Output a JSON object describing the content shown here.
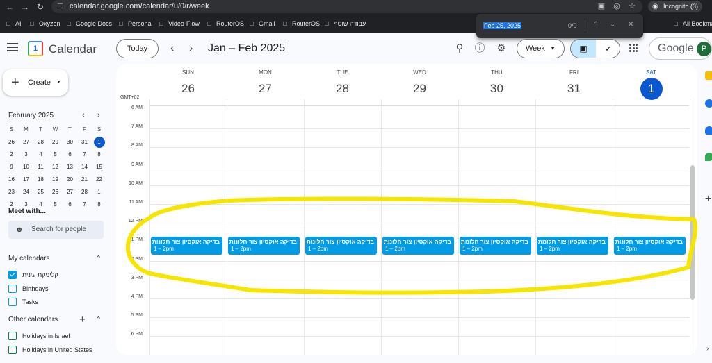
{
  "browser": {
    "url": "calendar.google.com/calendar/u/0/r/week",
    "incognito_label": "Incognito (3)",
    "bookmarks": [
      "AI",
      "Oxyzen",
      "Google Docs",
      "Personal",
      "Video-Flow",
      "RouterOS",
      "Gmail",
      "RouterOS",
      "עבודה שוטף",
      "All Bookmar"
    ],
    "find": {
      "query": "Feb 25, 2025",
      "count": "0/0"
    }
  },
  "header": {
    "app_name": "Calendar",
    "logo_day": "1",
    "today_label": "Today",
    "range_label": "Jan – Feb 2025",
    "view_label": "Week",
    "account_wordmark": "Google",
    "avatar_letter": "P"
  },
  "sidebar": {
    "create_label": "Create",
    "mini_calendar": {
      "title": "February 2025",
      "weekdays": [
        "S",
        "M",
        "T",
        "W",
        "T",
        "F",
        "S"
      ],
      "weeks": [
        [
          "26",
          "27",
          "28",
          "29",
          "30",
          "31",
          "1"
        ],
        [
          "2",
          "3",
          "4",
          "5",
          "6",
          "7",
          "8"
        ],
        [
          "9",
          "10",
          "11",
          "12",
          "13",
          "14",
          "15"
        ],
        [
          "16",
          "17",
          "18",
          "19",
          "20",
          "21",
          "22"
        ],
        [
          "23",
          "24",
          "25",
          "26",
          "27",
          "28",
          "1"
        ],
        [
          "2",
          "3",
          "4",
          "5",
          "6",
          "7",
          "8"
        ]
      ]
    },
    "meet_title": "Meet with...",
    "search_people_placeholder": "Search for people",
    "my_calendars_title": "My calendars",
    "my_calendars": [
      {
        "name": "קליניקת עינית",
        "checked": true
      },
      {
        "name": "Birthdays",
        "checked": false
      },
      {
        "name": "Tasks",
        "checked": false
      }
    ],
    "other_calendars_title": "Other calendars",
    "other_calendars": [
      {
        "name": "Holidays in Israel",
        "checked": false
      },
      {
        "name": "Holidays in United States",
        "checked": false
      }
    ]
  },
  "week": {
    "timezone": "GMT+02",
    "days": [
      {
        "name": "SUN",
        "date": "26",
        "today": false
      },
      {
        "name": "MON",
        "date": "27",
        "today": false
      },
      {
        "name": "TUE",
        "date": "28",
        "today": false
      },
      {
        "name": "WED",
        "date": "29",
        "today": false
      },
      {
        "name": "THU",
        "date": "30",
        "today": false
      },
      {
        "name": "FRI",
        "date": "31",
        "today": false
      },
      {
        "name": "SAT",
        "date": "1",
        "today": true
      }
    ],
    "hours": [
      "6 AM",
      "7 AM",
      "8 AM",
      "9 AM",
      "10 AM",
      "11 AM",
      "12 PM",
      "1 PM",
      "2 PM",
      "3 PM",
      "4 PM",
      "5 PM",
      "6 PM"
    ],
    "events": [
      {
        "day": 0,
        "title": "בדיקה אוקסיון צור חלונות",
        "time": "1 – 2pm"
      },
      {
        "day": 1,
        "title": "בדיקה אוקסיון צור חלונות",
        "time": "1 – 2pm"
      },
      {
        "day": 2,
        "title": "בדיקה אוקסיון צור חלונות",
        "time": "1 – 2pm"
      },
      {
        "day": 3,
        "title": "בדיקה אוקסיון צור חלונות",
        "time": "1 – 2pm"
      },
      {
        "day": 4,
        "title": "בדיקה אוקסיון צור חלונות",
        "time": "1 – 2pm"
      },
      {
        "day": 5,
        "title": "בדיקה אוקסיון צור חלונות",
        "time": "1 – 2pm"
      },
      {
        "day": 6,
        "title": "בדיקה אוקסיון צור חלונות",
        "time": "1 – 2pm"
      }
    ]
  },
  "colors": {
    "event": "#039be5",
    "today": "#0b57d0",
    "annotation": "#f5e500"
  },
  "icons": [
    "search-icon",
    "help-icon",
    "settings-icon",
    "calendar-view-icon",
    "tasks-view-icon",
    "apps-icon",
    "menu-icon"
  ]
}
